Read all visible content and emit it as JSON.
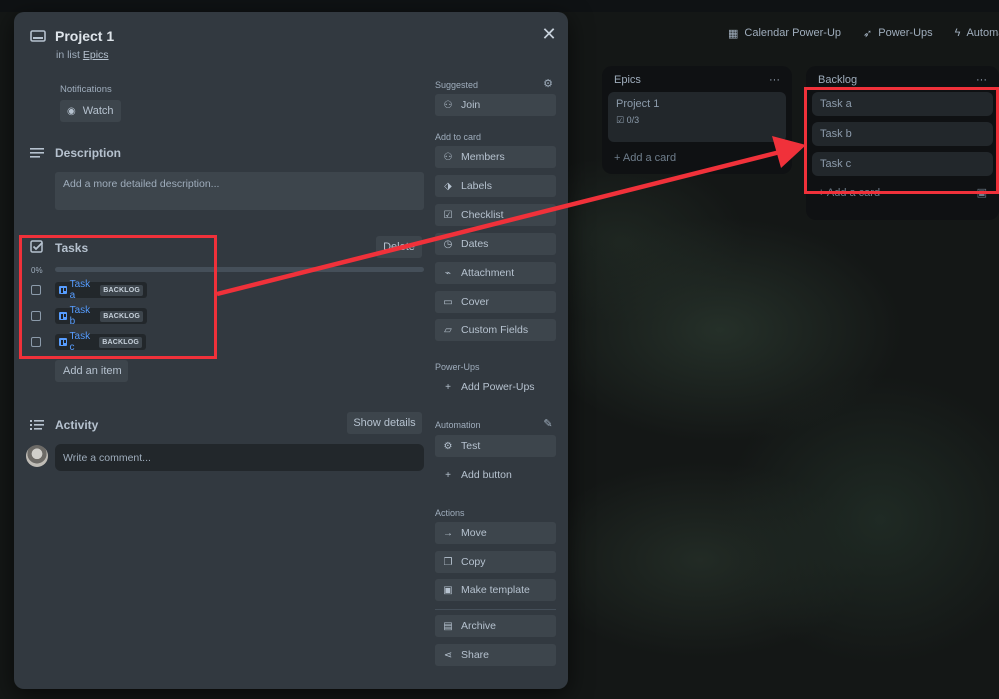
{
  "header": {
    "calendar": "Calendar Power-Up",
    "powerups": "Power-Ups",
    "automation": "Automati"
  },
  "epics_list": {
    "title": "Epics",
    "card_title": "Project 1",
    "card_badge": "0/3",
    "add_card": "Add a card"
  },
  "backlog_list": {
    "title": "Backlog",
    "cards": [
      "Task a",
      "Task b",
      "Task c"
    ],
    "add_card": "Add a card"
  },
  "card": {
    "title": "Project 1",
    "in_list_prefix": "in list",
    "list_name": "Epics",
    "notifications_label": "Notifications",
    "watch_label": "Watch",
    "description_title": "Description",
    "description_placeholder": "Add a more detailed description...",
    "tasks_title": "Tasks",
    "delete_label": "Delete",
    "progress_text": "0%",
    "progress": 0,
    "tasks": [
      {
        "name": "Task a",
        "list": "BACKLOG"
      },
      {
        "name": "Task b",
        "list": "BACKLOG"
      },
      {
        "name": "Task c",
        "list": "BACKLOG"
      }
    ],
    "add_item_label": "Add an item",
    "activity_title": "Activity",
    "show_details_label": "Show details",
    "comment_placeholder": "Write a comment..."
  },
  "sidebar": {
    "suggested_label": "Suggested",
    "join": "Join",
    "add_to_card_label": "Add to card",
    "members": "Members",
    "labels": "Labels",
    "checklist": "Checklist",
    "dates": "Dates",
    "attachment": "Attachment",
    "cover": "Cover",
    "custom_fields": "Custom Fields",
    "powerups_label": "Power-Ups",
    "add_powerups": "Add Power-Ups",
    "automation_label": "Automation",
    "test": "Test",
    "add_button": "Add button",
    "actions_label": "Actions",
    "move": "Move",
    "copy": "Copy",
    "make_template": "Make template",
    "archive": "Archive",
    "share": "Share"
  },
  "colors": {
    "annotation": "#f0313a",
    "modal_bg": "#323940",
    "button_bg": "#3d454c",
    "link": "#579dff"
  }
}
